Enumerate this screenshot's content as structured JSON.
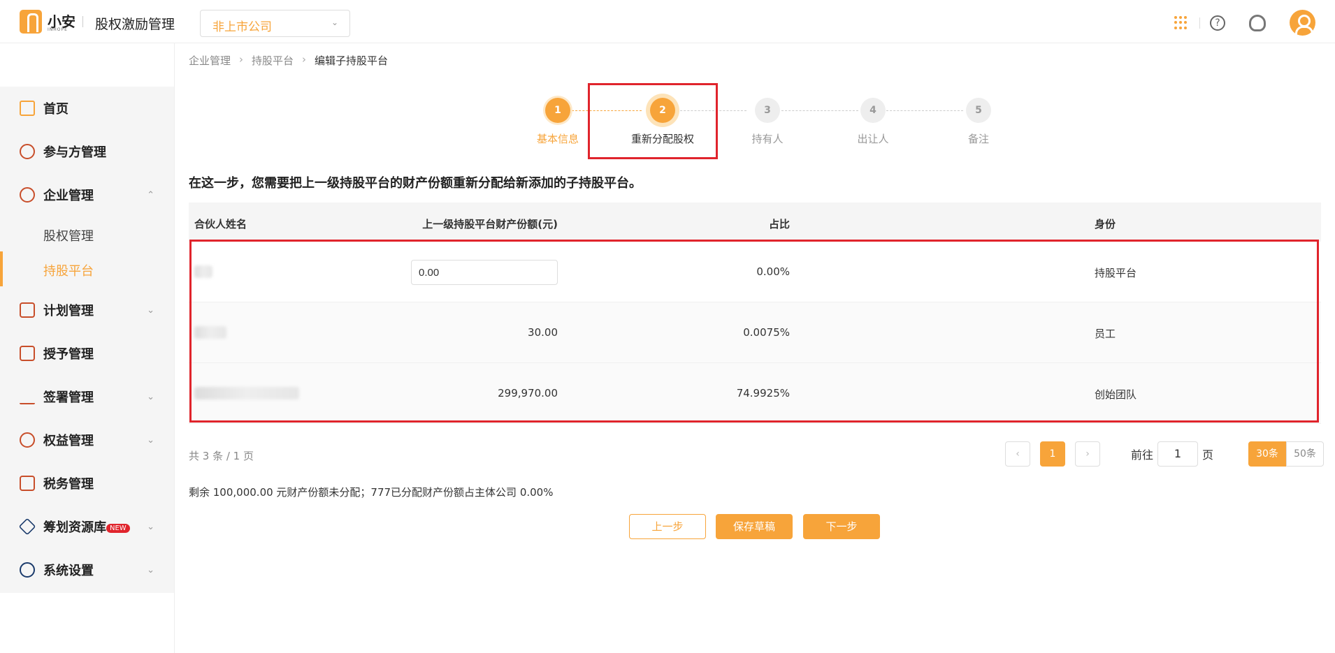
{
  "app": {
    "logo_text": "小安",
    "logo_sub": "INHOPE",
    "title": "股权激励管理",
    "company_select": "非上市公司"
  },
  "sidebar": {
    "items": [
      {
        "label": "首页"
      },
      {
        "label": "参与方管理"
      },
      {
        "label": "企业管理"
      },
      {
        "label": "计划管理"
      },
      {
        "label": "授予管理"
      },
      {
        "label": "签署管理"
      },
      {
        "label": "权益管理"
      },
      {
        "label": "税务管理"
      },
      {
        "label": "筹划资源库",
        "badge": "NEW"
      },
      {
        "label": "系统设置"
      }
    ],
    "sub_items": [
      {
        "label": "股权管理"
      },
      {
        "label": "持股平台"
      }
    ]
  },
  "breadcrumb": [
    "企业管理",
    "持股平台",
    "编辑子持股平台"
  ],
  "steps": [
    {
      "num": "1",
      "label": "基本信息",
      "state": "done"
    },
    {
      "num": "2",
      "label": "重新分配股权",
      "state": "current"
    },
    {
      "num": "3",
      "label": "持有人",
      "state": "todo"
    },
    {
      "num": "4",
      "label": "出让人",
      "state": "todo"
    },
    {
      "num": "5",
      "label": "备注",
      "state": "todo"
    }
  ],
  "intro": "在这一步，您需要把上一级持股平台的财产份额重新分配给新添加的子持股平台。",
  "table": {
    "headers": {
      "name": "合伙人姓名",
      "amount": "上一级持股平台财产份额(元)",
      "ratio": "占比",
      "role": "身份"
    },
    "rows": [
      {
        "amount": "0.00",
        "ratio": "0.00%",
        "role": "持股平台"
      },
      {
        "amount": "30.00",
        "ratio": "0.0075%",
        "role": "员工"
      },
      {
        "amount": "299,970.00",
        "ratio": "74.9925%",
        "role": "创始团队"
      }
    ]
  },
  "pagination": {
    "total": "共 3 条 / 1 页",
    "current_page": "1",
    "goto_prefix": "前往",
    "goto_value": "1",
    "goto_suffix": "页",
    "sizes": [
      "30条",
      "50条"
    ]
  },
  "remaining": "剩余 100,000.00 元财产份额未分配；777已分配财产份额占主体公司 0.00%",
  "buttons": {
    "prev": "上一步",
    "draft": "保存草稿",
    "next": "下一步"
  },
  "colors": {
    "accent": "#f7a43a",
    "highlight": "#e0242c"
  }
}
